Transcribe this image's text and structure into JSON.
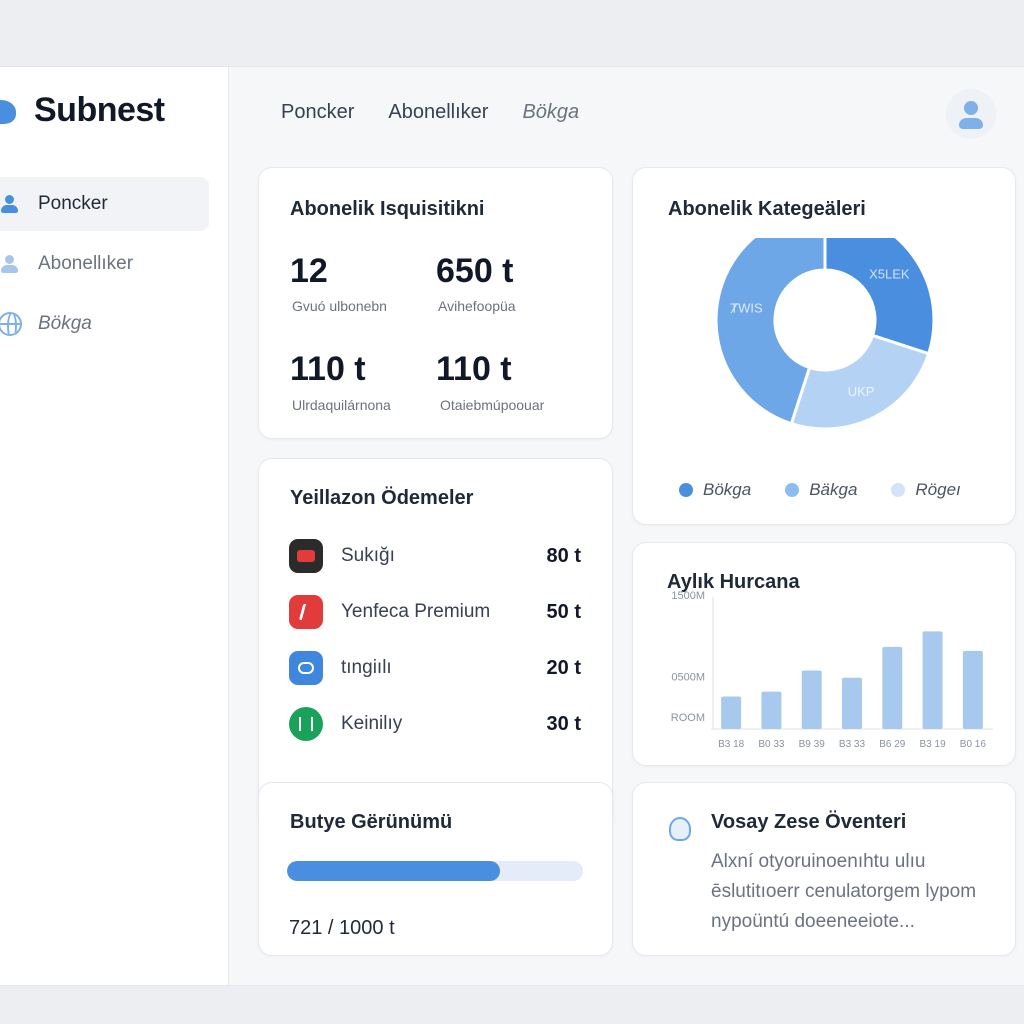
{
  "app": {
    "name": "Subnest"
  },
  "sidebar": {
    "items": [
      {
        "label": "Poncker",
        "active": true,
        "icon": "user-icon"
      },
      {
        "label": "Abonellıker",
        "active": false,
        "icon": "user-icon"
      },
      {
        "label": "Bökga",
        "active": false,
        "icon": "globe-icon"
      }
    ]
  },
  "topnav": {
    "items": [
      "Poncker",
      "Abonellıker",
      "Bökga"
    ]
  },
  "summary": {
    "title": "Abonelik Isquisitikni",
    "stats": [
      {
        "value": "12",
        "label": "Gvuó ulbonebn"
      },
      {
        "value": "650 t",
        "label": "Avihefoopüa"
      },
      {
        "value": "110 t",
        "label": "Ulrdaquilárnona"
      },
      {
        "value": "110 t",
        "label": "Otaiebmúpoouar"
      }
    ]
  },
  "categories": {
    "title": "Abonelik Kategeäleri",
    "slices": [
      {
        "label": "Bökga",
        "value": 30,
        "color": "#4a8fdf",
        "slice_text": "X5LEK"
      },
      {
        "label": "Bäkga",
        "value": 25,
        "color": "#b4d2f3",
        "slice_text": "UKP"
      },
      {
        "label": "Rögeı",
        "value": 45,
        "color": "#6ea7e8",
        "slice_text": "ȾWIS"
      }
    ],
    "legend_colors": [
      "#4a8fdf",
      "#8dbcf0",
      "#d3e4f8"
    ]
  },
  "payments": {
    "title": "Yeillazon Ödemeler",
    "items": [
      {
        "name": "Sukığı",
        "amount": "80 t",
        "icon": "stop-icon"
      },
      {
        "name": "Yenfeca Premium",
        "amount": "50 t",
        "icon": "music-icon"
      },
      {
        "name": "tıngiılı",
        "amount": "20 t",
        "icon": "cloud-icon"
      },
      {
        "name": "Keinilıy",
        "amount": "30 t",
        "icon": "leaf-icon"
      }
    ]
  },
  "monthly": {
    "title": "Aylık Hurcana",
    "chart_data": {
      "type": "bar",
      "categories": [
        "B3 18",
        "B0 33",
        "B9 39",
        "B3 33",
        "B6 29",
        "B3 19",
        "B0 16"
      ],
      "values": [
        400,
        460,
        720,
        630,
        1010,
        1200,
        960
      ],
      "y_tick_labels": [
        "ROOM",
        "0500M",
        "1500M"
      ],
      "y_tick_values": [
        0,
        500,
        1500
      ],
      "ylim": [
        0,
        1500
      ],
      "bar_color": "#a8c9ee"
    }
  },
  "budget": {
    "title": "Butye Gërünümü",
    "used": 721,
    "total": 1000,
    "text": "721 / 1000 t"
  },
  "tips": {
    "title": "Vosay Zese Öventeri",
    "text": "Alxní otyoruinoenıhtu ulıu ēslutitıoerr cenulatorgem lypom nypoüntú doeeneeiote..."
  }
}
